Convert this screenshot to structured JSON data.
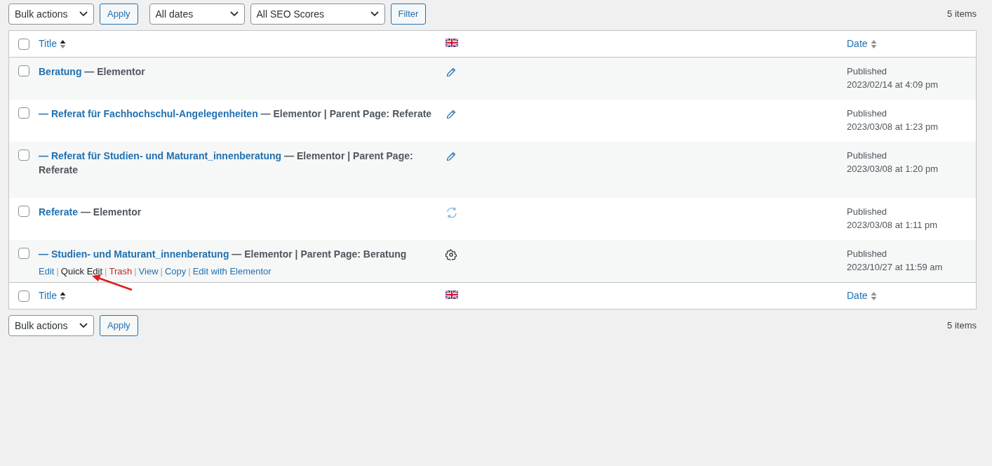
{
  "top_toolbar": {
    "bulk_actions": {
      "value": "Bulk actions"
    },
    "apply": "Apply",
    "date_filter": {
      "value": "All dates"
    },
    "seo_filter": {
      "value": "All SEO Scores"
    },
    "filter": "Filter",
    "count": "5 items"
  },
  "table": {
    "select_all_checked": false,
    "columns": [
      {
        "kind": "title",
        "label": "Title",
        "sorted": true
      },
      {
        "kind": "flag"
      },
      {
        "kind": "date",
        "label": "Date",
        "sorted": false
      }
    ],
    "rows": [
      {
        "title": "Beratung",
        "suffix": "— Elementor",
        "lang_status": {
          "kind": "pencil"
        },
        "status": "Published",
        "date": "2023/02/14 at 4:09 pm",
        "checked": false,
        "actions": []
      },
      {
        "title": "— Referat für Fachhochschul-Angelegenheiten",
        "suffix": "— Elementor | Parent Page: Referate",
        "lang_status": {
          "kind": "pencil"
        },
        "status": "Published",
        "date": "2023/03/08 at 1:23 pm",
        "checked": false,
        "actions": []
      },
      {
        "title": "— Referat für Studien- und Maturant_innenberatung",
        "suffix": "— Elementor | Parent Page: Referate",
        "lang_status": {
          "kind": "pencil"
        },
        "status": "Published",
        "date": "2023/03/08 at 1:20 pm",
        "checked": false,
        "actions": []
      },
      {
        "title": "Referate",
        "suffix": "— Elementor",
        "lang_status": {
          "kind": "sync"
        },
        "status": "Published",
        "date": "2023/03/08 at 1:11 pm",
        "checked": false,
        "actions": []
      },
      {
        "title": "— Studien- und Maturant_innenberatung",
        "suffix": "— Elementor | Parent Page: Beratung",
        "lang_status": {
          "kind": "gear"
        },
        "status": "Published",
        "date": "2023/10/27 at 11:59 am",
        "checked": false,
        "actions": [
          {
            "label": "Edit",
            "kind": "link"
          },
          {
            "label": "|",
            "kind": "separator"
          },
          {
            "label": "Quick Edit",
            "kind": "hover"
          },
          {
            "label": "|",
            "kind": "separator"
          },
          {
            "label": "Trash",
            "kind": "danger"
          },
          {
            "label": "|",
            "kind": "separator"
          },
          {
            "label": "View",
            "kind": "link"
          },
          {
            "label": "|",
            "kind": "separator"
          },
          {
            "label": "Copy",
            "kind": "link"
          },
          {
            "label": "|",
            "kind": "separator"
          },
          {
            "label": "Edit with Elementor",
            "kind": "link"
          }
        ]
      }
    ],
    "footer_columns": [
      {
        "kind": "title",
        "label": "Title",
        "sorted": true
      },
      {
        "kind": "flag"
      },
      {
        "kind": "date",
        "label": "Date",
        "sorted": false
      }
    ],
    "footer_select_all_checked": false
  },
  "bottom_toolbar": {
    "bulk_actions": {
      "value": "Bulk actions"
    },
    "apply": "Apply",
    "count": "5 items"
  }
}
